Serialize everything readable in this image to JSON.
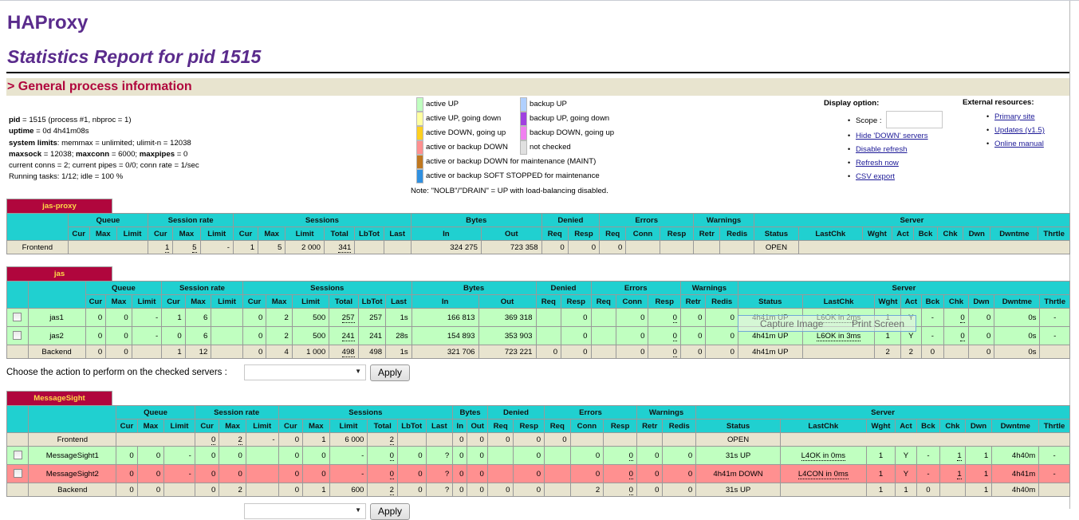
{
  "header": {
    "title": "HAProxy",
    "subtitle": "Statistics Report for pid 1515",
    "section": "> General process information"
  },
  "process_info": {
    "line1_key": "pid",
    "line1_val": " = 1515 (process #1, nbproc = 1)",
    "line2_key": "uptime",
    "line2_val": " = 0d 4h41m08s",
    "line3_key": "system limits",
    "line3_val": ": memmax = unlimited; ulimit-n = 12038",
    "line4_key1": "maxsock",
    "line4_val1": " = 12038; ",
    "line4_key2": "maxconn",
    "line4_val2": " = 6000; ",
    "line4_key3": "maxpipes",
    "line4_val3": " = 0",
    "line5": "current conns = 2; current pipes = 0/0; conn rate = 1/sec",
    "line6": "Running tasks: 1/12; idle = 100 %"
  },
  "legend": {
    "left": [
      {
        "label": "active UP",
        "color": "#c0ffc0"
      },
      {
        "label": "active UP, going down",
        "color": "#ffffa0"
      },
      {
        "label": "active DOWN, going up",
        "color": "#ffd020"
      },
      {
        "label": "active or backup DOWN",
        "color": "#ff9090"
      },
      {
        "label": "active or backup DOWN for maintenance (MAINT)",
        "color": "#c07820"
      },
      {
        "label": "active or backup SOFT STOPPED for maintenance",
        "color": "#3090e0"
      }
    ],
    "right": [
      {
        "label": "backup UP",
        "color": "#b0d0ff"
      },
      {
        "label": "backup UP, going down",
        "color": "#a040e0"
      },
      {
        "label": "backup DOWN, going up",
        "color": "#f080f0"
      },
      {
        "label": "not checked",
        "color": "#e0e0e0"
      }
    ],
    "note": "Note: \"NOLB\"/\"DRAIN\" = UP with load-balancing disabled."
  },
  "display_option": {
    "heading": "Display option:",
    "scope_label": "Scope :",
    "scope_value": "",
    "links": [
      "Hide 'DOWN' servers",
      "Disable refresh",
      "Refresh now",
      "CSV export"
    ]
  },
  "external_resources": {
    "heading": "External resources:",
    "links": [
      "Primary site",
      "Updates (v1.5)",
      "Online manual"
    ]
  },
  "table_headers": {
    "groups": [
      "Queue",
      "Session rate",
      "Sessions",
      "Bytes",
      "Denied",
      "Errors",
      "Warnings",
      "Server"
    ],
    "cols": [
      "Cur",
      "Max",
      "Limit",
      "Cur",
      "Max",
      "Limit",
      "Cur",
      "Max",
      "Limit",
      "Total",
      "LbTot",
      "Last",
      "In",
      "Out",
      "Req",
      "Resp",
      "Req",
      "Conn",
      "Resp",
      "Retr",
      "Redis",
      "Status",
      "LastChk",
      "Wght",
      "Act",
      "Bck",
      "Chk",
      "Dwn",
      "Dwntme",
      "Thrtle"
    ]
  },
  "proxies": [
    {
      "name": "jas-proxy",
      "rows": [
        {
          "type": "frontend",
          "name": "Frontend",
          "cells": [
            "",
            "",
            "",
            "1",
            "5",
            "-",
            "1",
            "5",
            "2 000",
            "341",
            "",
            "",
            "324 275",
            "723 358",
            "0",
            "0",
            "0",
            "",
            "",
            "",
            "",
            "OPEN",
            "",
            "",
            "",
            "",
            "",
            "",
            "",
            ""
          ]
        }
      ]
    },
    {
      "name": "jas",
      "rows": [
        {
          "type": "up",
          "name": "jas1",
          "cells": [
            "0",
            "0",
            "-",
            "1",
            "6",
            "",
            "0",
            "2",
            "500",
            "257",
            "257",
            "1s",
            "166 813",
            "369 318",
            "",
            "0",
            "",
            "0",
            "0",
            "0",
            "0",
            "4h41m UP",
            "L6OK in 2ms",
            "1",
            "Y",
            "-",
            "0",
            "0",
            "0s",
            "-"
          ]
        },
        {
          "type": "up",
          "name": "jas2",
          "cells": [
            "0",
            "0",
            "-",
            "0",
            "6",
            "",
            "0",
            "2",
            "500",
            "241",
            "241",
            "28s",
            "154 893",
            "353 903",
            "",
            "0",
            "",
            "0",
            "0",
            "0",
            "0",
            "4h41m UP",
            "L6OK in 3ms",
            "1",
            "Y",
            "-",
            "0",
            "0",
            "0s",
            "-"
          ]
        },
        {
          "type": "backend",
          "name": "Backend",
          "cells": [
            "0",
            "0",
            "",
            "1",
            "12",
            "",
            "0",
            "4",
            "1 000",
            "498",
            "498",
            "1s",
            "321 706",
            "723 221",
            "0",
            "0",
            "",
            "0",
            "0",
            "0",
            "0",
            "4h41m UP",
            "",
            "2",
            "2",
            "0",
            "",
            "0",
            "0s",
            ""
          ]
        }
      ],
      "action_label": "Choose the action to perform on the checked servers :",
      "action_value": "",
      "apply_label": "Apply"
    },
    {
      "name": "MessageSight",
      "rows": [
        {
          "type": "frontend",
          "name": "Frontend",
          "cells": [
            "",
            "",
            "",
            "0",
            "2",
            "-",
            "0",
            "1",
            "6 000",
            "2",
            "",
            "",
            "0",
            "0",
            "0",
            "0",
            "0",
            "",
            "",
            "",
            "",
            "OPEN",
            "",
            "",
            "",
            "",
            "",
            "",
            "",
            ""
          ]
        },
        {
          "type": "up",
          "name": "MessageSight1",
          "cells": [
            "0",
            "0",
            "-",
            "0",
            "0",
            "",
            "0",
            "0",
            "-",
            "0",
            "0",
            "?",
            "0",
            "0",
            "",
            "0",
            "",
            "0",
            "0",
            "0",
            "0",
            "31s UP",
            "L4OK in 0ms",
            "1",
            "Y",
            "-",
            "1",
            "1",
            "4h40m",
            "-"
          ]
        },
        {
          "type": "down",
          "name": "MessageSight2",
          "cells": [
            "0",
            "0",
            "-",
            "0",
            "0",
            "",
            "0",
            "0",
            "-",
            "0",
            "0",
            "?",
            "0",
            "0",
            "",
            "0",
            "",
            "0",
            "0",
            "0",
            "0",
            "4h41m DOWN",
            "L4CON in 0ms",
            "1",
            "Y",
            "-",
            "1",
            "1",
            "4h41m",
            "-"
          ]
        },
        {
          "type": "backend",
          "name": "Backend",
          "cells": [
            "0",
            "0",
            "",
            "0",
            "2",
            "",
            "0",
            "1",
            "600",
            "2",
            "0",
            "?",
            "0",
            "0",
            "0",
            "0",
            "",
            "2",
            "0",
            "0",
            "0",
            "31s UP",
            "",
            "1",
            "1",
            "0",
            "",
            "1",
            "4h40m",
            ""
          ]
        }
      ],
      "apply_label": "Apply"
    }
  ],
  "overlay": {
    "capture": "Capture Image",
    "print": "Print Screen"
  },
  "colors": {
    "title": "#5a2b8c",
    "section_text": "#b0063d",
    "section_bg": "#e8e4cf",
    "header_bg": "#20d0d0",
    "proxy_tab_bg": "#b0063d",
    "proxy_tab_text": "#ffdb47",
    "frontend_bg": "#e8e4cf",
    "active_up": "#c0ffc0",
    "down": "#ff9090"
  }
}
